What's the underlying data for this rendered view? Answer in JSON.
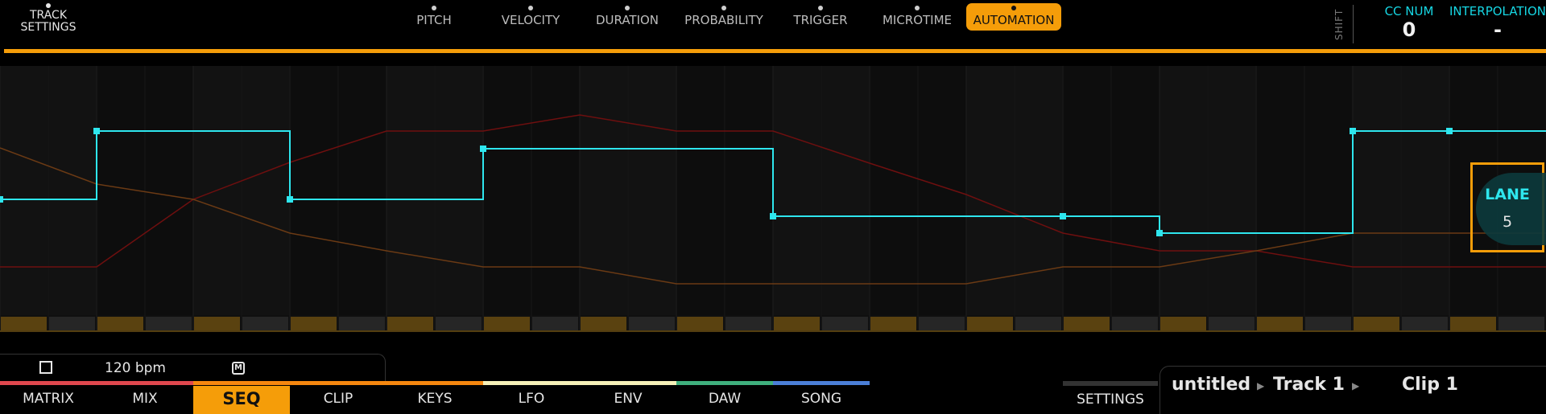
{
  "header": {
    "track_settings_line1": "TRACK",
    "track_settings_line2": "SETTINGS",
    "tabs": [
      {
        "label": "PITCH"
      },
      {
        "label": "VELOCITY"
      },
      {
        "label": "DURATION"
      },
      {
        "label": "PROBABILITY"
      },
      {
        "label": "TRIGGER"
      },
      {
        "label": "MICROTIME"
      },
      {
        "label": "AUTOMATION"
      }
    ],
    "active_tab": "AUTOMATION",
    "shift_label": "SHIFT",
    "cc_num_label": "CC NUM",
    "cc_num_value": "0",
    "interpolation_label": "INTERPOLATION",
    "interpolation_value": "-"
  },
  "lane": {
    "label": "LANE",
    "value": "5"
  },
  "transport": {
    "bpm": "120 bpm",
    "m_label": "M"
  },
  "bottom_nav": {
    "items": [
      {
        "label": "MATRIX"
      },
      {
        "label": "MIX"
      },
      {
        "label": "SEQ"
      },
      {
        "label": "CLIP"
      },
      {
        "label": "KEYS"
      },
      {
        "label": "LFO"
      },
      {
        "label": "ENV"
      },
      {
        "label": "DAW"
      },
      {
        "label": "SONG"
      }
    ],
    "settings_label": "SETTINGS"
  },
  "breadcrumb": {
    "project": "untitled",
    "track": "Track 1",
    "clip": "Clip 1"
  },
  "colors": {
    "accent": "#f59d09",
    "automation_line": "#2ee6ee",
    "lane_red": "#7a1010",
    "lane_brown": "#7a4416"
  }
}
